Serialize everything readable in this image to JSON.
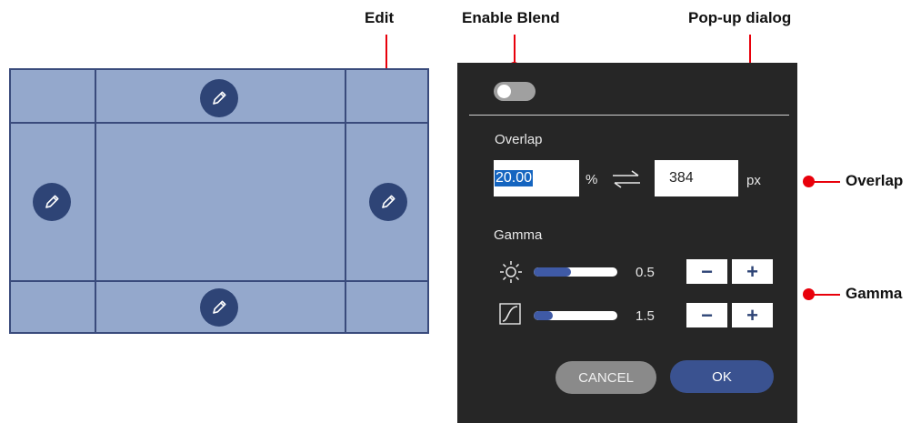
{
  "callouts": {
    "edit": "Edit",
    "enable_blend": "Enable Blend",
    "popup_dialog": "Pop-up dialog",
    "overlap": "Overlap",
    "gamma": "Gamma"
  },
  "grid": {
    "edit_buttons": [
      {
        "position": "top",
        "icon": "pencil-icon"
      },
      {
        "position": "left",
        "icon": "pencil-icon"
      },
      {
        "position": "right",
        "icon": "pencil-icon"
      },
      {
        "position": "bottom",
        "icon": "pencil-icon"
      }
    ]
  },
  "dialog": {
    "blend_enabled": false,
    "overlap": {
      "label": "Overlap",
      "percent_value": "20.00",
      "percent_unit": "%",
      "swap_icon": "swap-arrows-icon",
      "px_value": "384",
      "px_unit": "px"
    },
    "gamma": {
      "label": "Gamma",
      "rows": [
        {
          "icon": "brightness-icon",
          "value_label": "0.5",
          "fill_fraction": 0.45
        },
        {
          "icon": "curve-icon",
          "value_label": "1.5",
          "fill_fraction": 0.23
        }
      ],
      "minus_label": "−",
      "plus_label": "+"
    },
    "cancel_label": "CANCEL",
    "ok_label": "OK"
  },
  "colors": {
    "accent_red": "#e8000b",
    "grid_fill": "#94a8cc",
    "grid_line": "#3a4b7c",
    "button_navy": "#2e4476",
    "dialog_bg": "#262626",
    "cancel_gray": "#8a8a8a",
    "ok_blue": "#3a5290"
  }
}
